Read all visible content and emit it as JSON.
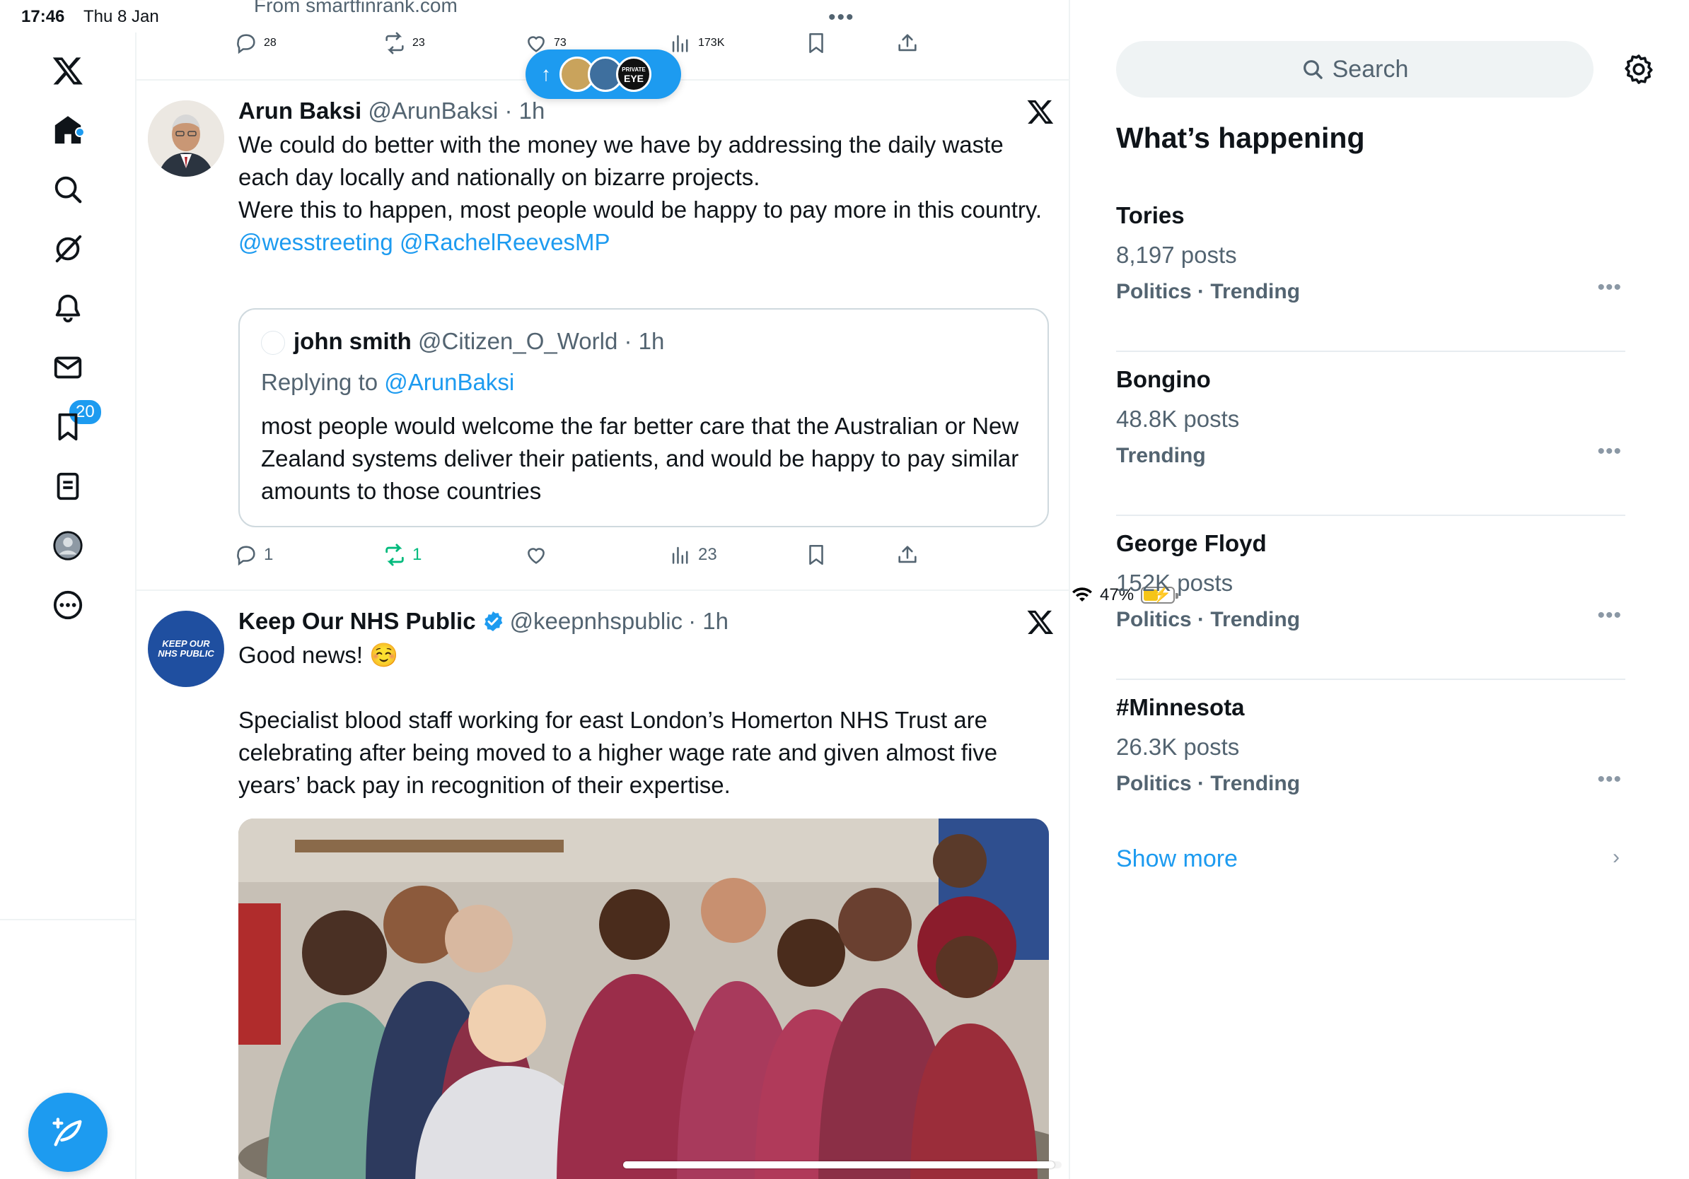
{
  "status_bar": {
    "time": "17:46",
    "date": "Thu 8 Jan",
    "battery": "47%",
    "battery_level": 0.47
  },
  "nav": {
    "notifications_badge": "20",
    "items": [
      "X",
      "Home",
      "Explore",
      "Grok",
      "Notifications",
      "Messages",
      "Bookmarks",
      "Lists",
      "Profile",
      "More"
    ]
  },
  "previous_tweet": {
    "source": "From smartfinrank.com",
    "replies": "28",
    "reposts": "23",
    "likes": "73",
    "views": "173K"
  },
  "new_posts_pill": {
    "eye_label_top": "PRIVATE",
    "eye_label_bottom": "EYE"
  },
  "tweets": [
    {
      "name": "Arun Baksi",
      "handle": "@ArunBaksi",
      "time": "· 1h",
      "text_line1": "We could do better with the money we have by addressing the daily waste each day locally and nationally on bizarre projects.",
      "text_line2": "Were this to happen, most people would be happy to pay more in this country.",
      "mention1": "@wesstreeting",
      "mention2": "@RachelReevesMP",
      "quote": {
        "name": "john smith",
        "handle": "@Citizen_O_World",
        "time": "· 1h",
        "replying_prefix": "Replying to ",
        "replying_handle": "@ArunBaksi",
        "text": "most people would welcome the far better care that the Australian or New Zealand systems deliver their patients, and would be happy to pay similar amounts to those countries"
      },
      "replies": "1",
      "reposts": "1",
      "views": "23"
    },
    {
      "name": "Keep Our NHS Public",
      "handle": "@keepnhspublic",
      "time": "· 1h",
      "avatar_text": "KEEP OUR NHS PUBLIC",
      "text_line1": "Good news! ☺️",
      "text_line2": "Specialist blood staff working for east London’s Homerton NHS Trust are celebrating after being moved to a higher wage rate and given almost five years’ back pay in recognition of their expertise."
    }
  ],
  "sidebar": {
    "search_placeholder": "Search",
    "title": "What’s happening",
    "trends": [
      {
        "topic": "Tories",
        "count": "8,197 posts",
        "meta": "Politics · Trending"
      },
      {
        "topic": "Bongino",
        "count": "48.8K posts",
        "meta": "Trending"
      },
      {
        "topic": "George Floyd",
        "count": "152K posts",
        "meta": "Politics · Trending"
      },
      {
        "topic": "#Minnesota",
        "count": "26.3K posts",
        "meta": "Politics · Trending"
      }
    ],
    "show_more": "Show more"
  },
  "colors": {
    "accent": "#1d9bf0",
    "repost_active": "#00ba7c",
    "muted": "#536471"
  }
}
